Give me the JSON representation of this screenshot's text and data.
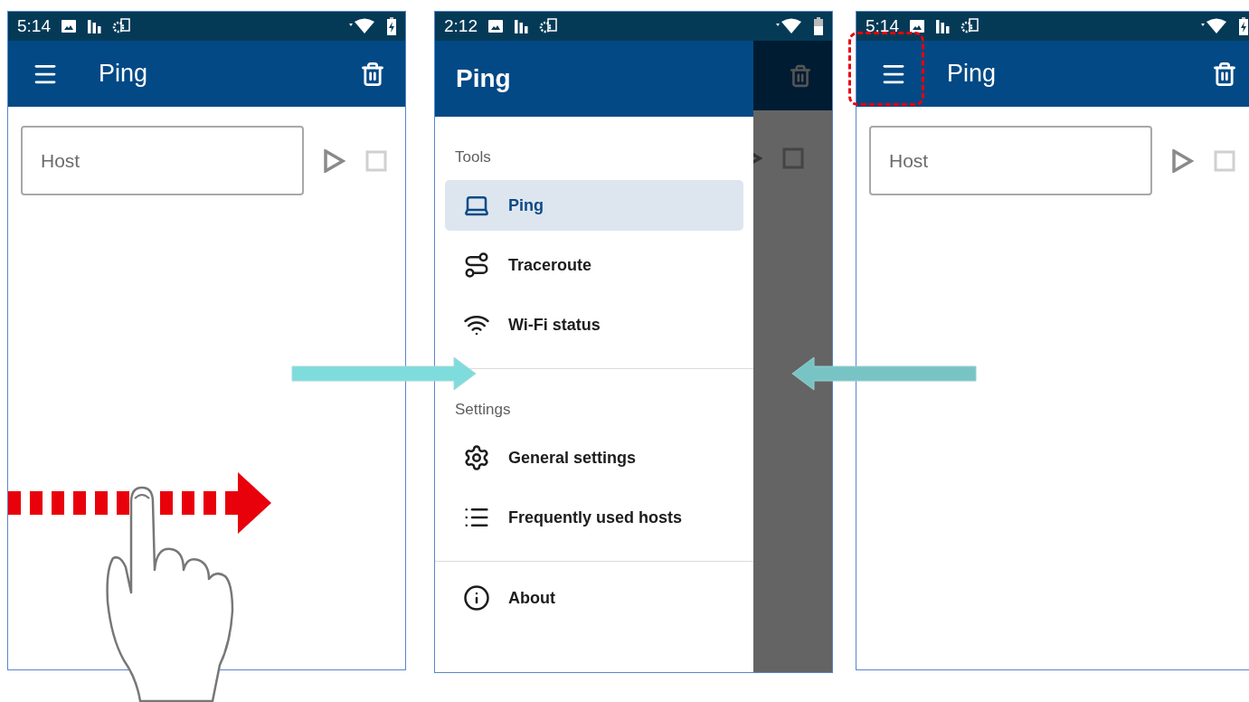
{
  "screens": [
    {
      "kind": "main",
      "status_time": "5:14",
      "charging": true,
      "title": "Ping",
      "host": {
        "placeholder": "Host"
      }
    },
    {
      "kind": "drawer",
      "status_time": "2:12",
      "charging": false,
      "drawer": {
        "title": "Ping",
        "sections": [
          {
            "heading": "Tools",
            "items": [
              {
                "label": "Ping",
                "selected": true
              },
              {
                "label": "Traceroute",
                "selected": false
              },
              {
                "label": "Wi-Fi status",
                "selected": false
              }
            ]
          },
          {
            "heading": "Settings",
            "items": [
              {
                "label": "General settings",
                "selected": false
              },
              {
                "label": "Frequently used hosts",
                "selected": false
              }
            ]
          },
          {
            "items": [
              {
                "label": "About",
                "selected": false
              }
            ]
          }
        ]
      }
    },
    {
      "kind": "main",
      "status_time": "5:14",
      "charging": true,
      "title": "Ping",
      "host": {
        "placeholder": "Host"
      }
    }
  ]
}
